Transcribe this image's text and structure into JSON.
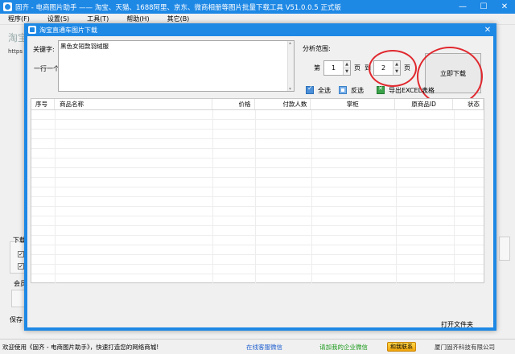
{
  "main_window": {
    "title": "固齐 - 电商图片助手 —— 淘宝、天猫、1688阿里、京东、微商相册等图片批量下载工具 V51.0.0.5 正式版",
    "controls": {
      "minimize": "—",
      "maximize": "☐",
      "close": "✕"
    }
  },
  "menu": {
    "items": [
      "程序(F)",
      "设置(S)",
      "工具(T)",
      "帮助(H)",
      "其它(B)"
    ]
  },
  "background": {
    "taobao_text": "淘宝",
    "url_text": "https",
    "download_label": "下载",
    "member_label": "会员",
    "save_label": "保存"
  },
  "dialog": {
    "title": "淘宝直通车图片下载",
    "close": "✕",
    "keyword_label": "关键字:",
    "keyword_hint": "一行一个",
    "keyword_value": "黑色女短款羽绒服",
    "range_label": "分析范围:",
    "page_prefix": "第",
    "page_suffix": "页",
    "page_to": "到",
    "page_from_value": "1",
    "page_to_value": "2",
    "spin_up": "▲",
    "spin_down": "▼",
    "start_button": "立即下载",
    "select_all": "全选",
    "invert_select": "反选",
    "export_excel": "导出EXCEL表格",
    "table_headers": [
      "序号",
      "商品名称",
      "价格",
      "付款人数",
      "掌柜",
      "原商品ID",
      "状态"
    ],
    "open_folder": "打开文件夹"
  },
  "statusbar": {
    "welcome": "欢迎使用《固齐 - 电商图片助手》，快速打造您的网络商城!",
    "online_service": "在线客服微信",
    "add_wechat": "请加我的企业微信",
    "qq_contact": "和我联系",
    "company": "厦门固齐科技有限公司"
  },
  "colors": {
    "titlebar_blue": "#1e88e5",
    "annotation_red": "#e0282e"
  }
}
